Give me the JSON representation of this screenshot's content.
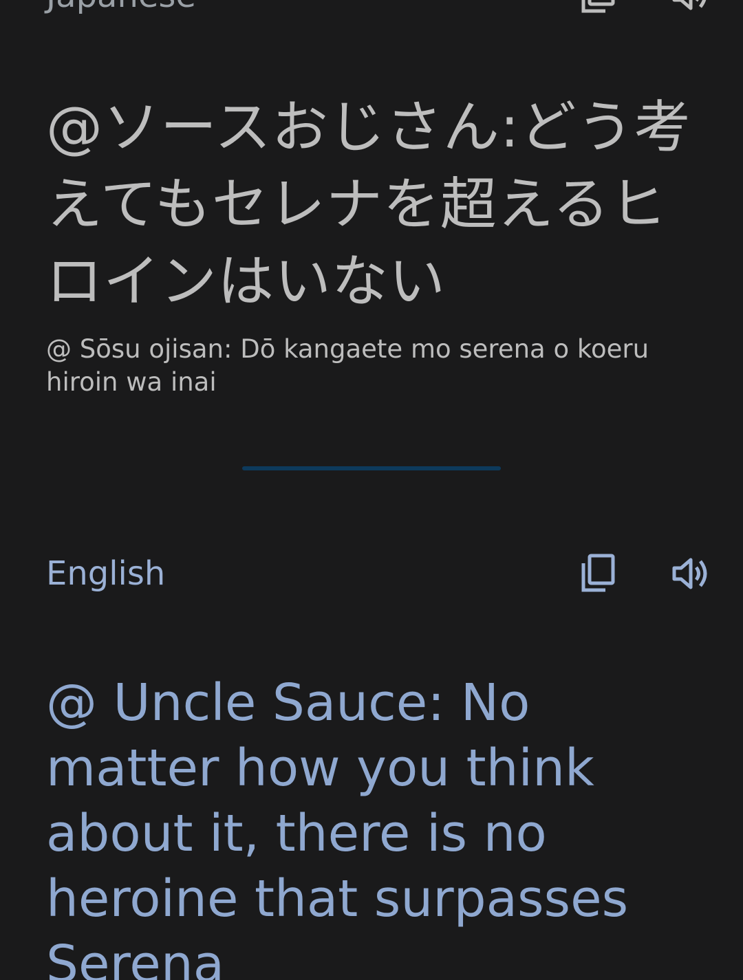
{
  "source": {
    "language": "Japanese",
    "text": "@ソースおじさん:どう考えてもセレナを超えるヒロインはいない",
    "romanization": "@ Sōsu ojisan: Dō kangaete mo serena o koeru hiroin wa inai",
    "icons": {
      "copy": "copy-icon",
      "speak": "speaker-icon"
    }
  },
  "target": {
    "language": "English",
    "text": "@ Uncle Sauce: No matter how you think about it, there is no heroine that surpasses Serena",
    "icons": {
      "copy": "copy-icon",
      "speak": "speaker-icon"
    }
  },
  "colors": {
    "background": "#1a1a1b",
    "source_text": "#bdbdbd",
    "target_text": "#8fa8d0",
    "divider": "#0d3a5c"
  }
}
